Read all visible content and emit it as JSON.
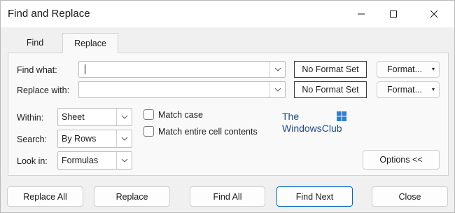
{
  "window": {
    "title": "Find and Replace"
  },
  "tabs": [
    {
      "label": "Find",
      "active": false
    },
    {
      "label": "Replace",
      "active": true
    }
  ],
  "find_what": {
    "label": "Find what:",
    "value": "",
    "format_status": "No Format Set",
    "format_button": "Format..."
  },
  "replace_with": {
    "label": "Replace with:",
    "value": "",
    "format_status": "No Format Set",
    "format_button": "Format..."
  },
  "options": {
    "within": {
      "label": "Within:",
      "value": "Sheet"
    },
    "search": {
      "label": "Search:",
      "value": "By Rows"
    },
    "look_in": {
      "label": "Look in:",
      "value": "Formulas"
    },
    "match_case": {
      "label": "Match case",
      "checked": false
    },
    "match_entire": {
      "label": "Match entire cell contents",
      "checked": false
    },
    "options_button": "Options <<"
  },
  "watermark": {
    "line1": "The",
    "line2": "WindowsClub"
  },
  "buttons": {
    "replace_all": "Replace All",
    "replace": "Replace",
    "find_all": "Find All",
    "find_next": "Find Next",
    "close": "Close"
  },
  "colors": {
    "accent": "#0067c0",
    "logo_blue": "#1a4a8a"
  }
}
